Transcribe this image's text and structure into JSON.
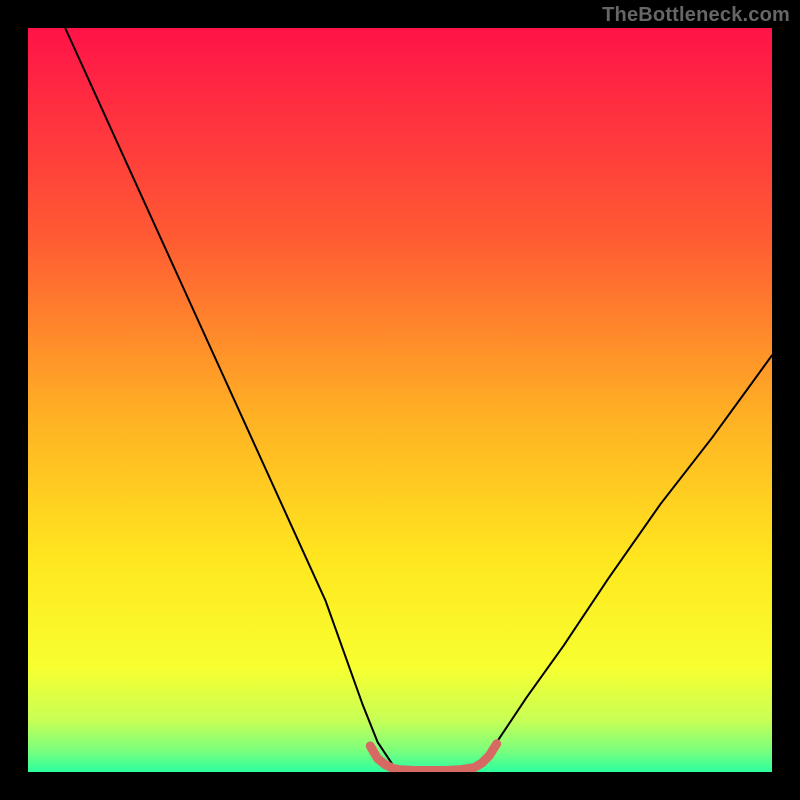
{
  "watermark": "TheBottleneck.com",
  "chart_data": {
    "type": "line",
    "title": "",
    "xlabel": "",
    "ylabel": "",
    "xlim": [
      0,
      100
    ],
    "ylim": [
      0,
      100
    ],
    "grid": false,
    "legend": false,
    "background_gradient": {
      "type": "linear-vertical",
      "stops": [
        {
          "offset": 0.0,
          "color": "#ff1348"
        },
        {
          "offset": 0.28,
          "color": "#ff5a33"
        },
        {
          "offset": 0.52,
          "color": "#ffb024"
        },
        {
          "offset": 0.72,
          "color": "#ffe81f"
        },
        {
          "offset": 0.86,
          "color": "#f7ff30"
        },
        {
          "offset": 0.93,
          "color": "#c8ff55"
        },
        {
          "offset": 0.97,
          "color": "#7dff7b"
        },
        {
          "offset": 1.0,
          "color": "#2bffa0"
        }
      ]
    },
    "series": [
      {
        "name": "bottleneck-curve",
        "color": "#000000",
        "width": 2,
        "x": [
          5,
          10,
          15,
          20,
          25,
          30,
          35,
          40,
          45,
          47,
          49,
          51,
          55,
          59,
          61,
          63,
          67,
          72,
          78,
          85,
          92,
          100
        ],
        "y": [
          100,
          89,
          78,
          67,
          56,
          45,
          34,
          23,
          9,
          4,
          1,
          0,
          0,
          0,
          1,
          4,
          10,
          17,
          26,
          36,
          45,
          56
        ]
      },
      {
        "name": "optimal-band",
        "color": "#d66a63",
        "width": 9,
        "x": [
          46,
          47,
          48,
          49,
          50,
          52,
          54,
          56,
          58,
          60,
          61,
          62,
          63
        ],
        "y": [
          3.5,
          1.8,
          1.0,
          0.5,
          0.3,
          0.2,
          0.2,
          0.2,
          0.3,
          0.6,
          1.2,
          2.2,
          3.8
        ]
      }
    ]
  }
}
